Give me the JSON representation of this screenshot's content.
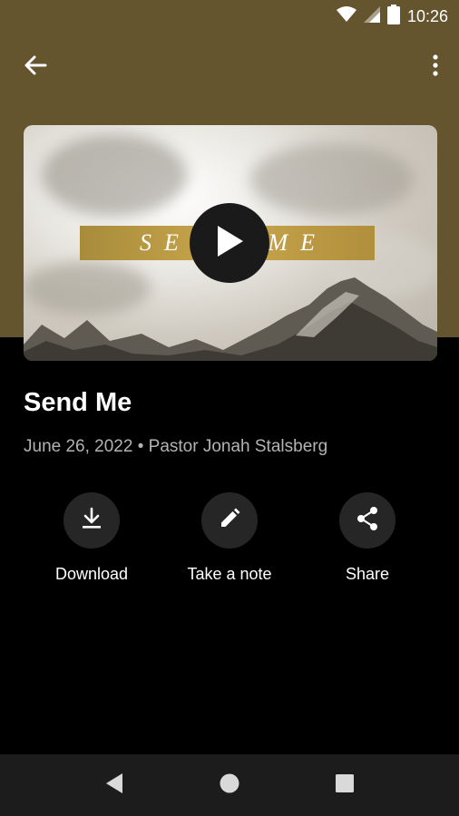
{
  "status_bar": {
    "time": "10:26",
    "icons": [
      "wifi-icon",
      "signal-icon",
      "battery-icon"
    ]
  },
  "app_bar": {
    "back_icon": "back-arrow-icon",
    "menu_icon": "more-vert-icon"
  },
  "hero": {
    "overlay_text": "SEND ME",
    "play_icon": "play-icon"
  },
  "sermon": {
    "title": "Send Me",
    "meta": "June 26, 2022 • Pastor Jonah Stalsberg"
  },
  "actions": [
    {
      "label": "Download",
      "icon": "download-icon"
    },
    {
      "label": "Take a note",
      "icon": "pencil-icon"
    },
    {
      "label": "Share",
      "icon": "share-icon"
    }
  ],
  "nav": {
    "icons": [
      "back-triangle-icon",
      "home-circle-icon",
      "recents-square-icon"
    ]
  },
  "colors": {
    "header": "#65552e",
    "background": "#000000",
    "band": "#b8983f",
    "action_circle": "#262626",
    "meta_text": "#b3b3b3",
    "nav_bar": "#1c1c1c"
  }
}
